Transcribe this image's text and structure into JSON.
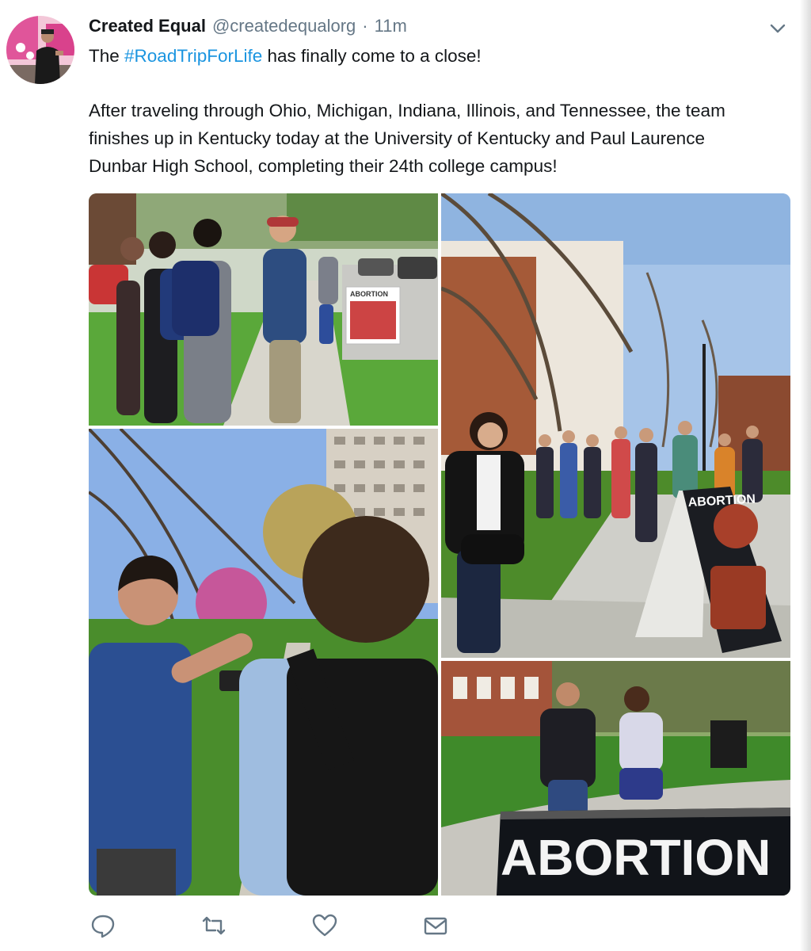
{
  "tweet": {
    "display_name": "Created Equal",
    "handle": "@createdequalorg",
    "separator": "·",
    "time": "11m",
    "line1_prefix": "The ",
    "hashtag": "#RoadTripForLife",
    "line1_suffix": " has finally come to a close!",
    "paragraph2": [
      "After traveling through Ohio, Michigan, Indiana, Illinois, and Tennessee, the team",
      "finishes up in Kentucky today at the University of Kentucky and Paul Laurence",
      "Dunbar High School, completing their 24th college campus!"
    ]
  },
  "media": {
    "sign_text_large": "ABORTION",
    "sign_text_small": "ABORTION"
  },
  "icons": {
    "caret": "chevron-down-icon",
    "reply": "reply-icon",
    "retweet": "retweet-icon",
    "like": "heart-icon",
    "dm": "envelope-icon"
  },
  "colors": {
    "hashtag": "#1b95e0",
    "name": "#14171a",
    "meta": "#657786",
    "icon": "#657786"
  }
}
